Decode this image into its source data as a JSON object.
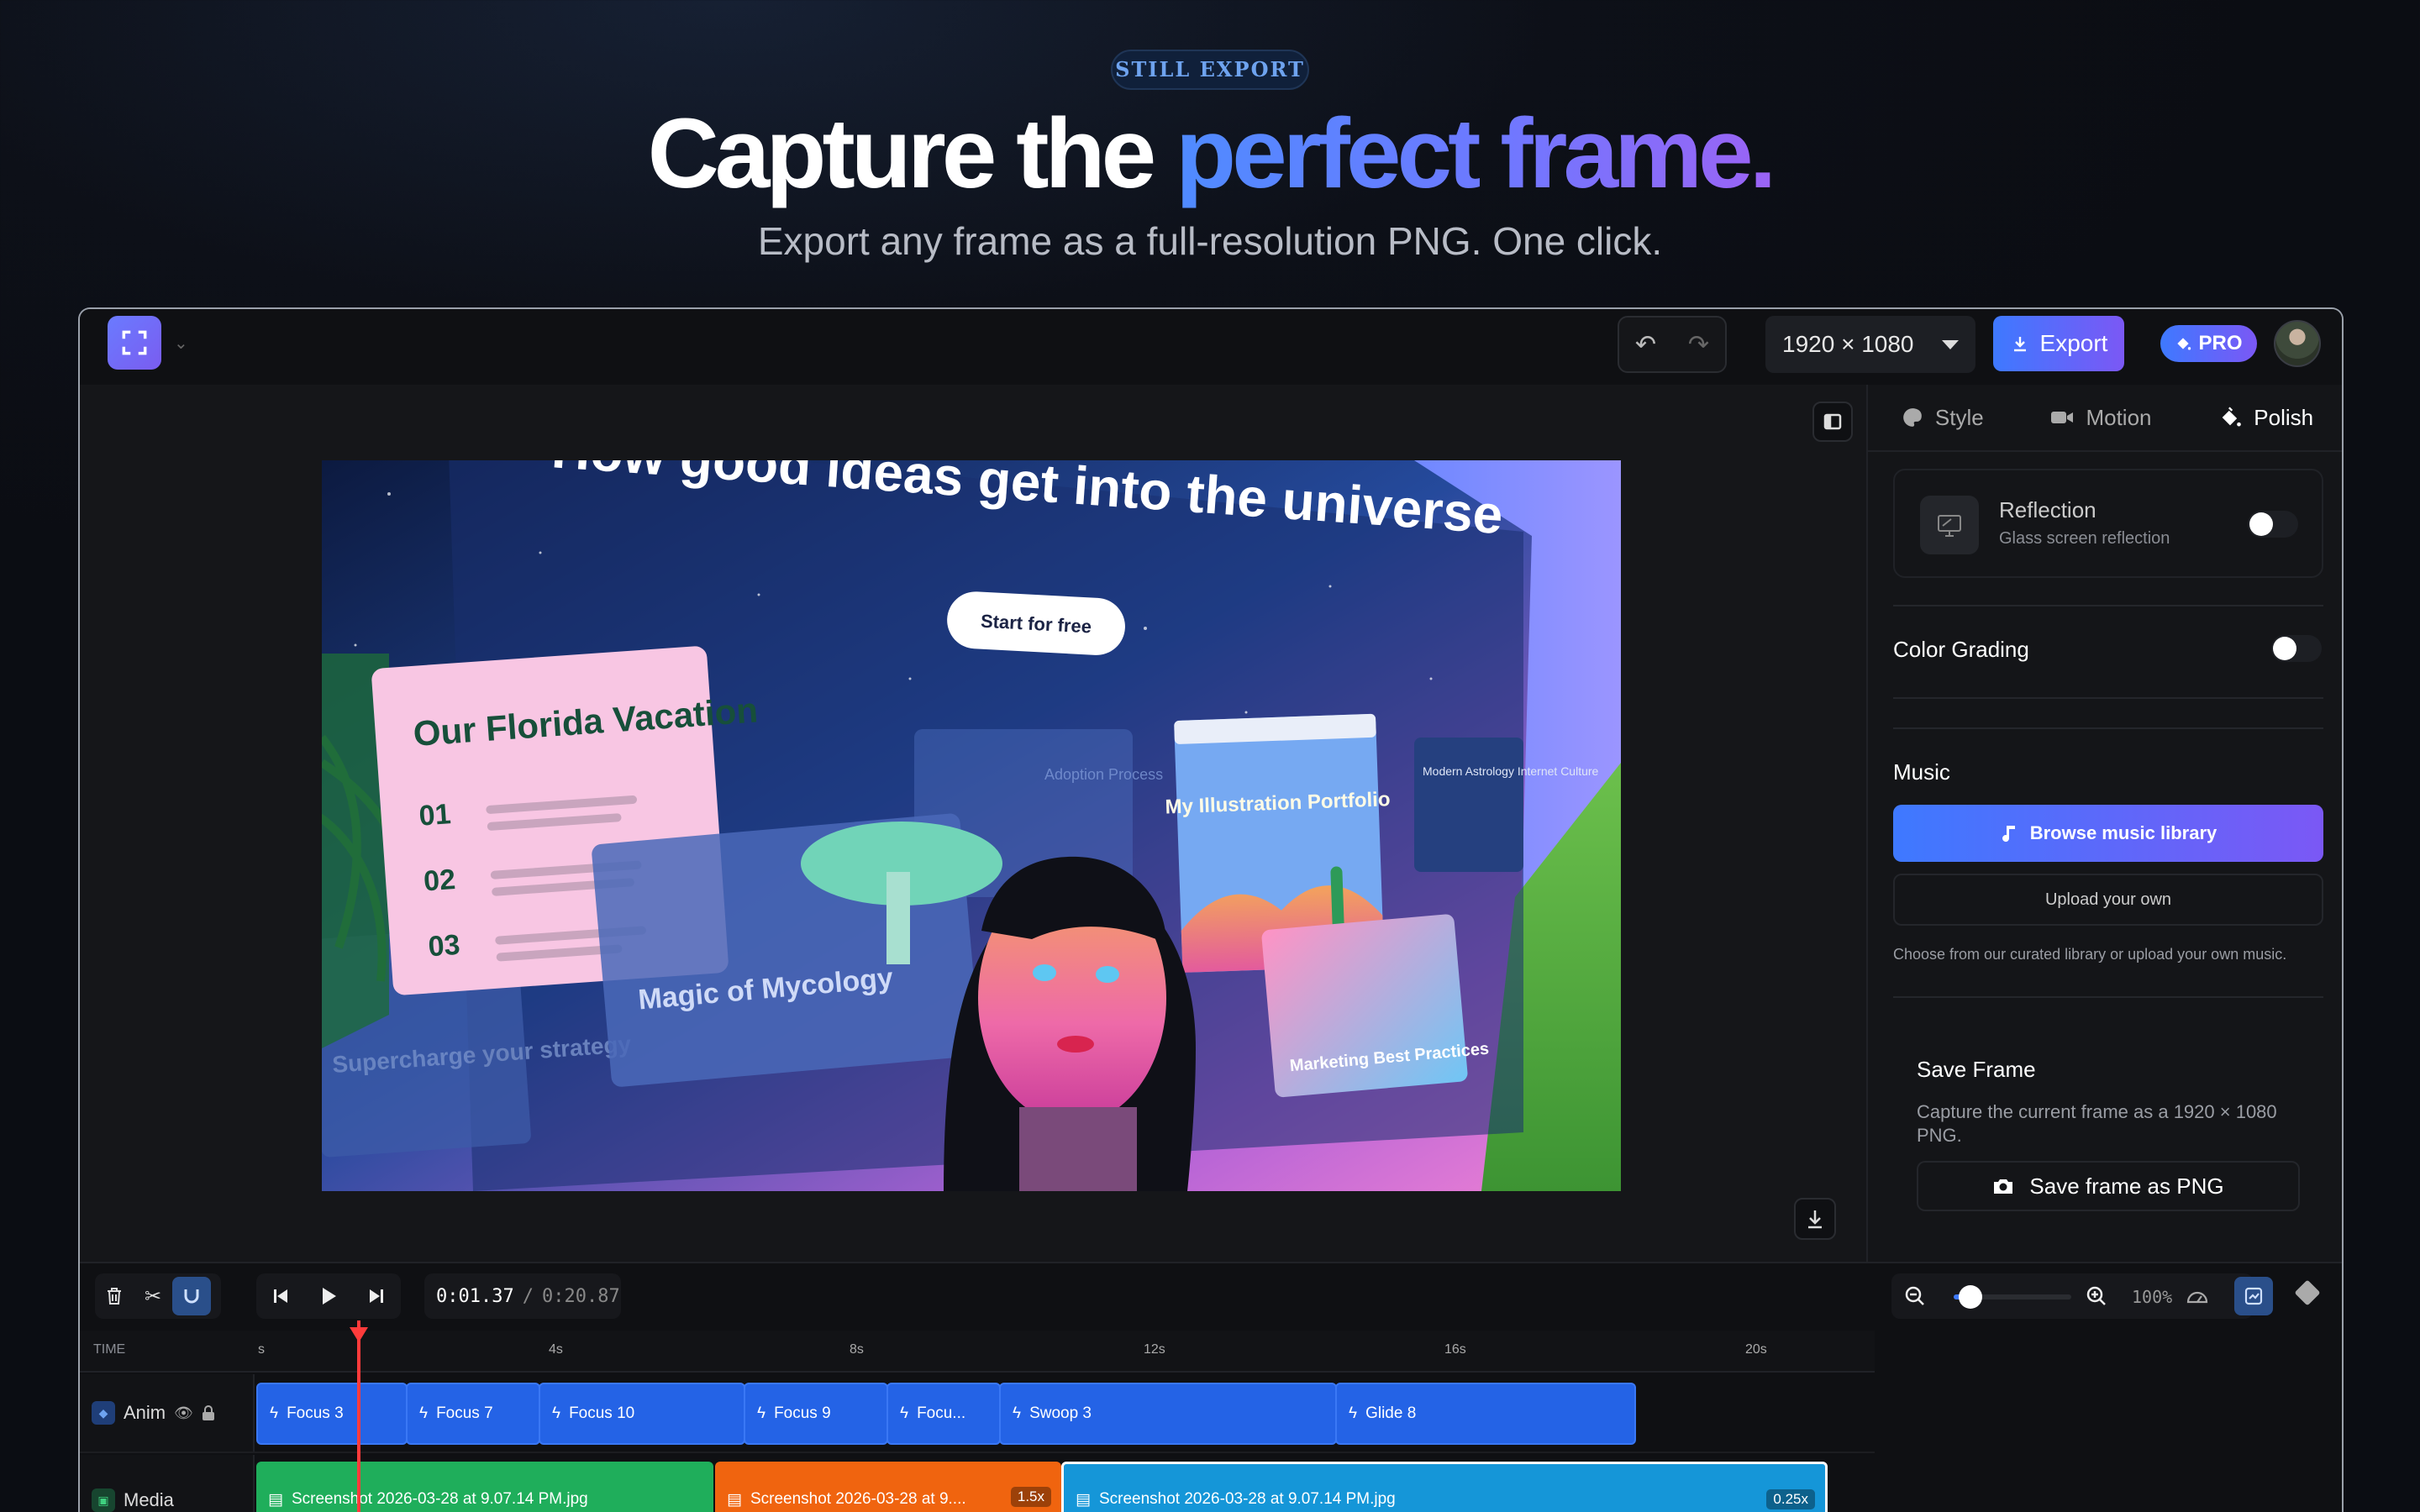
{
  "hero": {
    "eyebrow": "STILL EXPORT",
    "headline_plain": "Capture the ",
    "headline_accent": "perfect frame.",
    "subtitle": "Export any frame as a full-resolution PNG. One click."
  },
  "toolbar": {
    "resolution": "1920 × 1080",
    "export_label": "Export",
    "plan_badge": "PRO"
  },
  "preview": {
    "headline": "How good ideas get into the universe",
    "cta": "Start for free",
    "card_florida_title": "Our Florida Vacation",
    "card_florida_items": [
      "01",
      "02",
      "03"
    ],
    "card_mycology": "Magic of Mycology",
    "card_portfolio": "My Illustration Portfolio",
    "card_marketing": "Marketing Best Practices",
    "card_astrology": "Modern Astrology Internet Culture",
    "card_strategy": "Supercharge your strategy",
    "card_adoption": "Adoption Process"
  },
  "panel": {
    "tabs": [
      {
        "label": "Style",
        "icon": "palette-icon"
      },
      {
        "label": "Motion",
        "icon": "video-icon"
      },
      {
        "label": "Polish",
        "icon": "paint-bucket-icon"
      }
    ],
    "active_tab": "Polish",
    "reflection": {
      "title": "Reflection",
      "subtitle": "Glass screen reflection",
      "enabled": false
    },
    "color_grading": {
      "title": "Color Grading",
      "enabled": false
    },
    "music": {
      "title": "Music",
      "browse_label": "Browse music library",
      "upload_label": "Upload your own",
      "hint": "Choose from our curated library or upload your own music."
    },
    "save_frame": {
      "title": "Save Frame",
      "description": "Capture the current frame as a 1920 × 1080 PNG.",
      "button_label": "Save frame as PNG"
    }
  },
  "timeline": {
    "current_time": "0:01.37",
    "separator": "/",
    "total_time": "0:20.87",
    "zoom_percent": "100%",
    "time_label": "TIME",
    "ticks": [
      "s",
      "4s",
      "8s",
      "12s",
      "16s",
      "20s"
    ],
    "anim_track": {
      "label": "Anim",
      "clips": [
        "Focus 3",
        "Focus 7",
        "Focus 10",
        "Focus 9",
        "Focu...",
        "Swoop 3",
        "Glide 8"
      ]
    },
    "media_track": {
      "label": "Media",
      "clips": [
        {
          "label": "Screenshot 2026-03-28 at 9.07.14 PM.jpg",
          "speed": "",
          "color": "#1fae5b"
        },
        {
          "label": "Screenshot 2026-03-28 at 9....",
          "speed": "1.5x",
          "color": "#f0640f"
        },
        {
          "label": "Screenshot 2026-03-28 at 9.07.14 PM.jpg",
          "speed": "0.25x",
          "color": "#1596d8"
        }
      ]
    }
  },
  "colors": {
    "accent_start": "#3e79ff",
    "accent_end": "#7b58f5",
    "playhead": "#ff3b3b",
    "background": "#0d1018"
  }
}
